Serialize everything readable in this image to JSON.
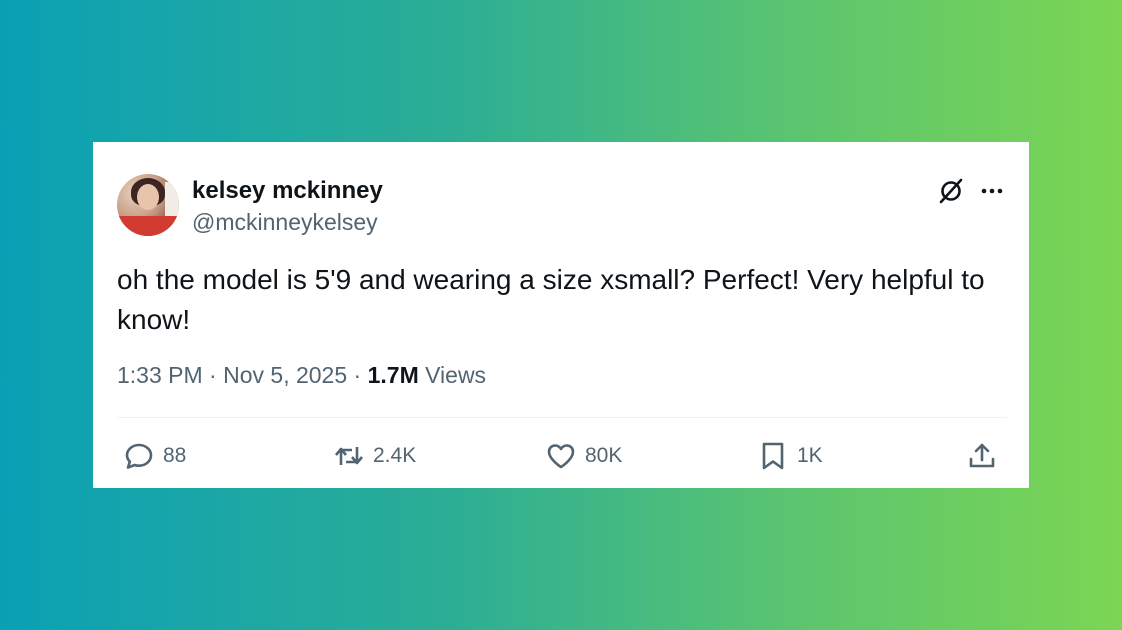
{
  "tweet": {
    "author_name": "kelsey mckinney",
    "author_handle": "@mckinneykelsey",
    "text": "oh the model is 5'9 and wearing a size xsmall? Perfect! Very helpful to know!",
    "time": "1:33 PM",
    "date": "Nov 5, 2025",
    "views_count": "1.7M",
    "views_label": "Views",
    "separator": "·"
  },
  "actions": {
    "reply_count": "88",
    "retweet_count": "2.4K",
    "like_count": "80K",
    "bookmark_count": "1K"
  },
  "icons": {
    "top_right": [
      "grok-icon",
      "more-icon"
    ],
    "actions": [
      "reply-icon",
      "retweet-icon",
      "like-icon",
      "bookmark-icon",
      "share-icon"
    ]
  },
  "colors": {
    "gradient_start": "#0aa0b5",
    "gradient_end": "#7bd653",
    "text_primary": "#0f1419",
    "text_secondary": "#536471",
    "card_background": "#ffffff"
  }
}
